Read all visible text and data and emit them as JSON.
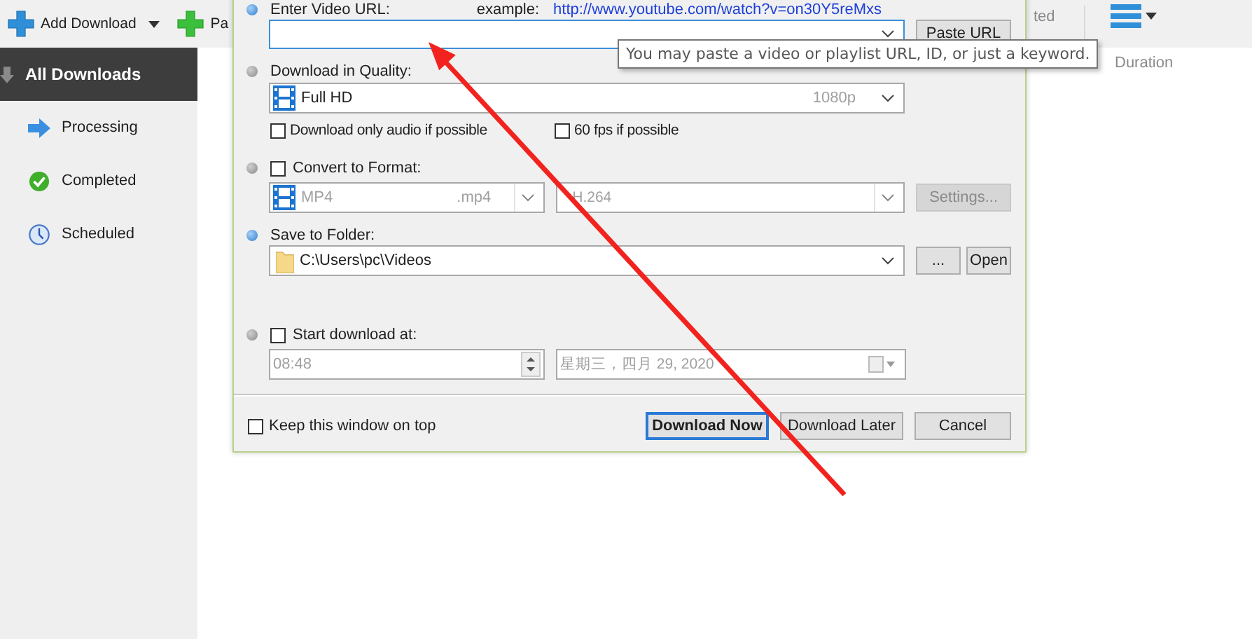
{
  "toolbar": {
    "buttons": [
      {
        "label": "Add Download",
        "kind": "add"
      },
      {
        "label": "Pa",
        "kind": "paste"
      }
    ],
    "tab_fragment": "ted"
  },
  "sidebar": {
    "items": [
      {
        "label": "All Downloads",
        "kind": "all",
        "selected": true
      },
      {
        "label": "Processing",
        "kind": "processing",
        "selected": false
      },
      {
        "label": "Completed",
        "kind": "completed",
        "selected": false
      },
      {
        "label": "Scheduled",
        "kind": "scheduled",
        "selected": false
      }
    ]
  },
  "table": {
    "columns": [
      "Duration"
    ]
  },
  "dialog": {
    "url": {
      "label": "Enter Video URL:",
      "active": true,
      "example_label": "example:",
      "example_link": "http://www.youtube.com/watch?v=on30Y5reMxs",
      "button": "Paste URL"
    },
    "quality": {
      "label": "Download in Quality:",
      "active": false,
      "value": "Full HD",
      "detail": "1080p"
    },
    "options": [
      {
        "label": "Download only audio if possible",
        "checked": false
      },
      {
        "label": "60 fps if possible",
        "checked": false
      }
    ],
    "convert": {
      "label": "Convert to Format:",
      "active": false,
      "checked": false,
      "format": "MP4",
      "extension": ".mp4",
      "codec": "H.264",
      "button": "Settings..."
    },
    "folder": {
      "label": "Save to Folder:",
      "active": true,
      "value": "C:\\Users\\pc\\Videos",
      "buttons": [
        "...",
        "Open"
      ]
    },
    "schedule": {
      "label": "Start download at:",
      "active": false,
      "checked": false,
      "time": "08:48",
      "date": "星期三，四月  29, 2020"
    },
    "keep_on_top": {
      "label": "Keep this window on top",
      "checked": false
    },
    "buttons": [
      {
        "label": "Download Now",
        "default": true
      },
      {
        "label": "Download Later",
        "default": false
      },
      {
        "label": "Cancel",
        "default": false
      }
    ]
  },
  "tooltip": "You may paste a video or playlist URL, ID, or just a keyword."
}
